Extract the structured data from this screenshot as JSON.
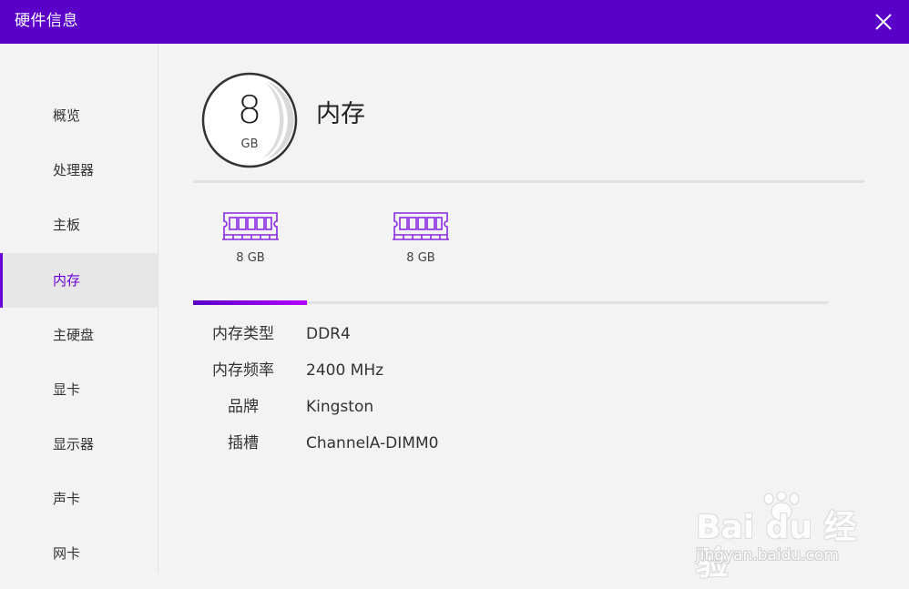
{
  "window": {
    "title": "硬件信息",
    "close_icon": "close-icon"
  },
  "colors": {
    "accent": "#5a00c8",
    "accent_light": "#b300ff",
    "background": "#f3f3f3"
  },
  "sidebar": {
    "items": [
      {
        "label": "概览",
        "active": false
      },
      {
        "label": "处理器",
        "active": false
      },
      {
        "label": "主板",
        "active": false
      },
      {
        "label": "内存",
        "active": true
      },
      {
        "label": "主硬盘",
        "active": false
      },
      {
        "label": "显卡",
        "active": false
      },
      {
        "label": "显示器",
        "active": false
      },
      {
        "label": "声卡",
        "active": false
      },
      {
        "label": "网卡",
        "active": false
      }
    ]
  },
  "summary": {
    "value": "8",
    "unit": "GB",
    "title": "内存"
  },
  "modules": [
    {
      "icon": "ram-icon",
      "label": "8 GB",
      "selected": true
    },
    {
      "icon": "ram-icon",
      "label": "8 GB",
      "selected": false
    }
  ],
  "specs": [
    {
      "key": "内存类型",
      "value": "DDR4"
    },
    {
      "key": "内存频率",
      "value": "2400 MHz"
    },
    {
      "key": "品牌",
      "value": "Kingston"
    },
    {
      "key": "插槽",
      "value": "ChannelA-DIMM0"
    }
  ],
  "watermark": {
    "brand": "Bai du 经验",
    "url": "jingyan.baidu.com"
  }
}
